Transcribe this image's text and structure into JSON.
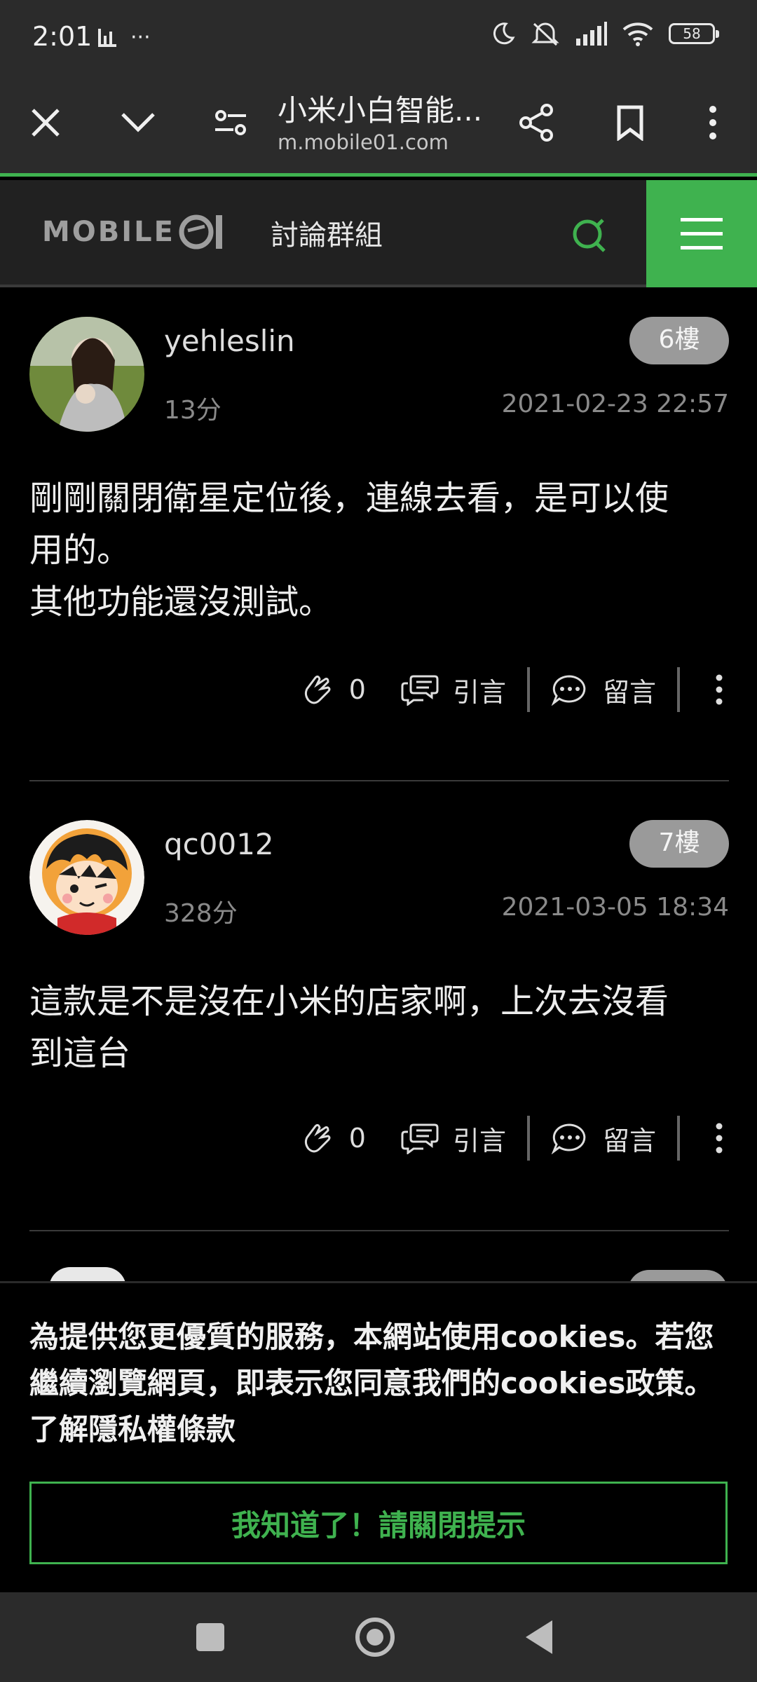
{
  "status_bar": {
    "time": "2:01",
    "more": "···",
    "battery": "58",
    "icons": [
      "chart-icon",
      "moon-icon",
      "mute-icon",
      "signal-icon",
      "wifi-icon",
      "battery-icon"
    ]
  },
  "browser": {
    "title": "小米小白智能...",
    "domain": "m.mobile01.com",
    "icons": [
      "close-icon",
      "chevron-down-icon",
      "site-settings-icon",
      "share-icon",
      "bookmark-icon",
      "more-vert-icon"
    ]
  },
  "site": {
    "logo_text": "MOBILE",
    "section_title": "討論群組",
    "accent": "#3fb24f"
  },
  "posts": [
    {
      "username": "yehleslin",
      "score": "13分",
      "floor": "6樓",
      "date": "2021-02-23 22:57",
      "body": "剛剛關閉衛星定位後，連線去看，是可以使\n用的。\n其他功能還沒測試。",
      "likes": "0",
      "quote_label": "引言",
      "comment_label": "留言"
    },
    {
      "username": "qc0012",
      "score": "328分",
      "floor": "7樓",
      "date": "2021-03-05 18:34",
      "body": "這款是不是沒在小米的店家啊，上次去沒看\n到這台",
      "likes": "0",
      "quote_label": "引言",
      "comment_label": "留言"
    }
  ],
  "cookie_banner": {
    "text": "為提供您更優質的服務，本網站使用cookies。若您繼續瀏覽網頁，即表示您同意我們的cookies政策。",
    "privacy_link": "了解隱私權條款",
    "button": "我知道了！請關閉提示"
  }
}
